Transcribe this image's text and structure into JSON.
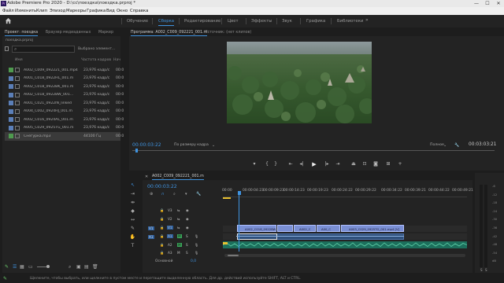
{
  "titlebar": {
    "title": "Adobe Premiere Pro 2020 - D:\\сс\\поездка\\поездка.prproj *",
    "min": "—",
    "max": "☐",
    "close": "✕"
  },
  "menu": [
    "Файл",
    "Изменить",
    "Клип",
    "Эпизод",
    "Маркеры",
    "Графика",
    "Вид",
    "Окно",
    "Справка"
  ],
  "workspaces": [
    "Обучение",
    "Сборка",
    "Редактирование",
    "Цвет",
    "Эффекты",
    "Звук",
    "Графика",
    "Библиотеки"
  ],
  "workspace_active": 1,
  "project": {
    "tabs": [
      "Проект: поездка",
      "Браузер медиаданных",
      "Маркер"
    ],
    "project_file": "поездка.prproj",
    "search_placeholder": "",
    "selected_info": "Выбрано элемент...",
    "columns": {
      "name": "Имя",
      "fps": "Частота кадров",
      "start": "Нач"
    },
    "files": [
      {
        "name": "A002_C009_092221_001.mp4",
        "fps": "23,976 кадр/с",
        "start": "00:0",
        "color": "#4f9a4f"
      },
      {
        "name": "A001_C018_0922HL_001.m",
        "fps": "23,976 кадр/с",
        "start": "00:0",
        "color": "#5b7fb8"
      },
      {
        "name": "A002_C018_0922BK_001.m",
        "fps": "23,976 кадр/с",
        "start": "00:0",
        "color": "#5b7fb8"
      },
      {
        "name": "A002_C018_0922BW_001...",
        "fps": "23,976 кадр/с",
        "start": "00:0",
        "color": "#5b7fb8"
      },
      {
        "name": "A001_C021_0922IN_linked",
        "fps": "23,976 кадр/с",
        "start": "00:0",
        "color": "#5b7fb8"
      },
      {
        "name": "A004_C002_0924HJ_001.m",
        "fps": "23,976 кадр/с",
        "start": "00:0",
        "color": "#5b7fb8"
      },
      {
        "name": "A002_C016_0924AL_001.m",
        "fps": "23,976 кадр/с",
        "start": "00:0",
        "color": "#5b7fb8"
      },
      {
        "name": "A005_C029_0925TG_001.m",
        "fps": "23,976 кадр/с",
        "start": "00:0",
        "color": "#5b7fb8"
      },
      {
        "name": "Снегурка.mp3",
        "fps": "44100 Гц",
        "start": "00:0",
        "color": "#4f9a4f"
      }
    ]
  },
  "program": {
    "tabs": [
      "Программа: A002_C009_092221_001.m",
      "Источник: (нет клипов)"
    ],
    "timecode": "00:00:03:22",
    "fit": "По размеру кадра",
    "quality": "Полное",
    "duration": "00:03:03:21"
  },
  "timeline": {
    "tab": "A002_C009_092221_001.m",
    "timecode": "00:00:03:22",
    "ruler": [
      "00:00",
      "00:00:04:23",
      "00:00:09:23",
      "00:00:14:23",
      "00:00:19:23",
      "00:00:24:22",
      "00:00:29:22",
      "00:00:34:22",
      "00:00:39:21",
      "00:00:44:22",
      "00:00:49:21"
    ],
    "tracks": {
      "video": [
        "V3",
        "V2",
        "V1"
      ],
      "audio": [
        "A1",
        "A2",
        "A3"
      ],
      "source_v": "V1",
      "source_a": "A1"
    },
    "master_label": "Основной",
    "master_value": "0,0",
    "clips": [
      {
        "label": "A002_C018_0922BW_001.mp4"
      },
      {
        "label": "A002_C"
      },
      {
        "label": "A00_C"
      },
      {
        "label": "A003_C029_0925TG_001.mp4 [V]"
      }
    ]
  },
  "meter": {
    "scale": [
      "-6",
      "-12",
      "-18",
      "-24",
      "-30",
      "-36",
      "-42",
      "-48",
      "-54",
      "dB"
    ]
  },
  "status": {
    "message": "Щелкните, чтобы выбрать, или щелкните в пустом месте и перетащите выделенную область. Для др. действий используйте SHIFT, ALT и CTRL."
  }
}
